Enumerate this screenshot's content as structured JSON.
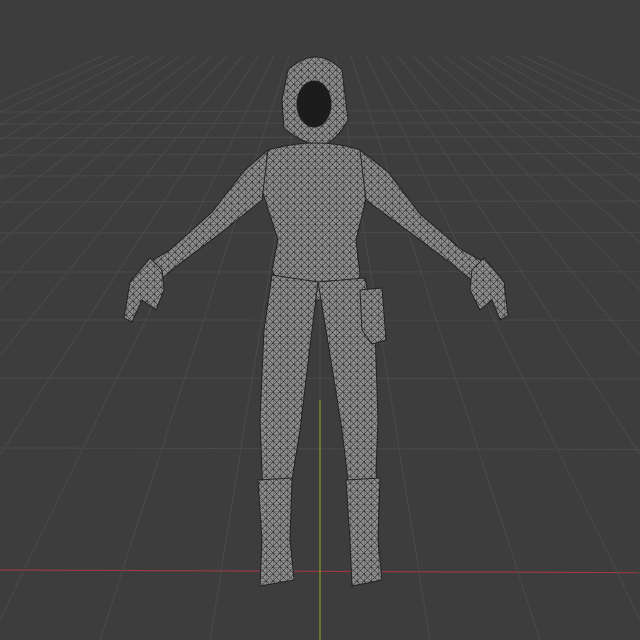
{
  "viewport": {
    "mode": "wireframe",
    "colors": {
      "background": "#3d3d3d",
      "grid": "#4a4a4a",
      "axis_x": "#9b3a44",
      "axis_y": "#7f9a2c",
      "mesh_fill": "#8c8c8c",
      "mesh_wire": "#2a2a2a"
    }
  }
}
